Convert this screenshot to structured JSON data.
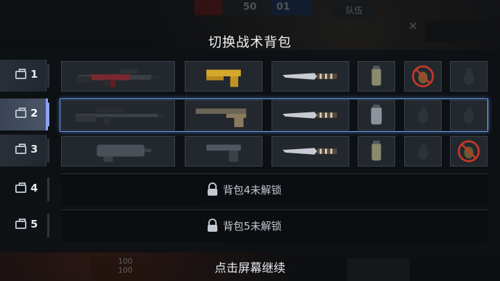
{
  "title": "切换战术背包",
  "footer": "点击屏幕继续",
  "hud": {
    "score_left": "50",
    "score_right": "01",
    "team_button": "队伍",
    "hp_a": "100",
    "hp_b": "100"
  },
  "loadouts": [
    {
      "number": "1",
      "active": false,
      "main": "m4a1-rifle-icon",
      "pistol": "desert-eagle-gold-icon",
      "knife": "combat-knife-icon",
      "g1": "smoke-grenade-icon",
      "g2": "grenade-forbidden-icon",
      "g3": "grenade-empty-icon"
    },
    {
      "number": "2",
      "active": true,
      "main": "sniper-rifle-icon",
      "pistol": "pistol-tan-icon",
      "knife": "combat-knife-icon",
      "g1": "flash-grenade-icon",
      "g2": "grenade-empty-icon",
      "g3": "grenade-empty-icon"
    },
    {
      "number": "3",
      "active": false,
      "main": "p90-smg-icon",
      "pistol": "beretta-pistol-icon",
      "knife": "combat-knife-icon",
      "g1": "smoke-grenade-icon",
      "g2": "grenade-empty-icon",
      "g3": "frag-grenade-forbidden-icon"
    }
  ],
  "locked": [
    {
      "number": "4",
      "text": "背包4未解锁"
    },
    {
      "number": "5",
      "text": "背包5未解锁"
    }
  ],
  "colors": {
    "accent": "#6fa8ff",
    "forbidden": "#c0392b",
    "gold": "#d4a82c"
  }
}
